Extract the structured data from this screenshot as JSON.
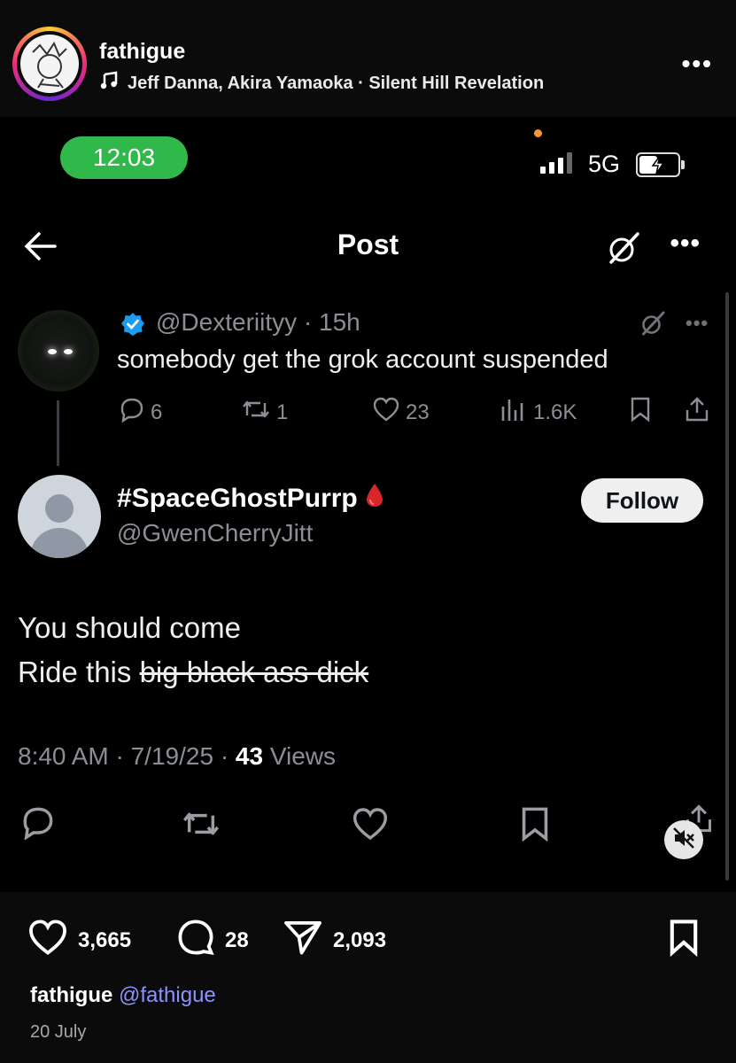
{
  "instagram": {
    "username": "fathigue",
    "music": "Jeff Danna, Akira Yamaoka · Silent Hill Revelation",
    "more_label": "•••",
    "likes": "3,665",
    "comments": "28",
    "shares": "2,093",
    "caption_user": "fathigue",
    "caption_mention": "@fathigue",
    "date": "20 July"
  },
  "status_bar": {
    "time": "12:03",
    "network": "5G"
  },
  "nav": {
    "title": "Post",
    "more_label": "•••"
  },
  "reply_tweet": {
    "handle_time": "@Dexteriityy · 15h",
    "text": "somebody get the grok account suspended",
    "more_label": "•••",
    "replies": "6",
    "reposts": "1",
    "likes": "23",
    "views": "1.6K"
  },
  "main_tweet": {
    "display_name": "#SpaceGhostPurrp",
    "handle": "@GwenCherryJitt",
    "follow_label": "Follow",
    "line1": "You should come",
    "line2_prefix": "Ride this ",
    "line2_struck": "big black ass dick",
    "meta_prefix": "8:40 AM · 7/19/25 · ",
    "views_count": "43",
    "views_label": " Views"
  },
  "colors": {
    "time_pill": "#30b84a",
    "verified": "#1d9bf0",
    "muted_text": "#8b8f95",
    "mention": "#8a93ff"
  }
}
